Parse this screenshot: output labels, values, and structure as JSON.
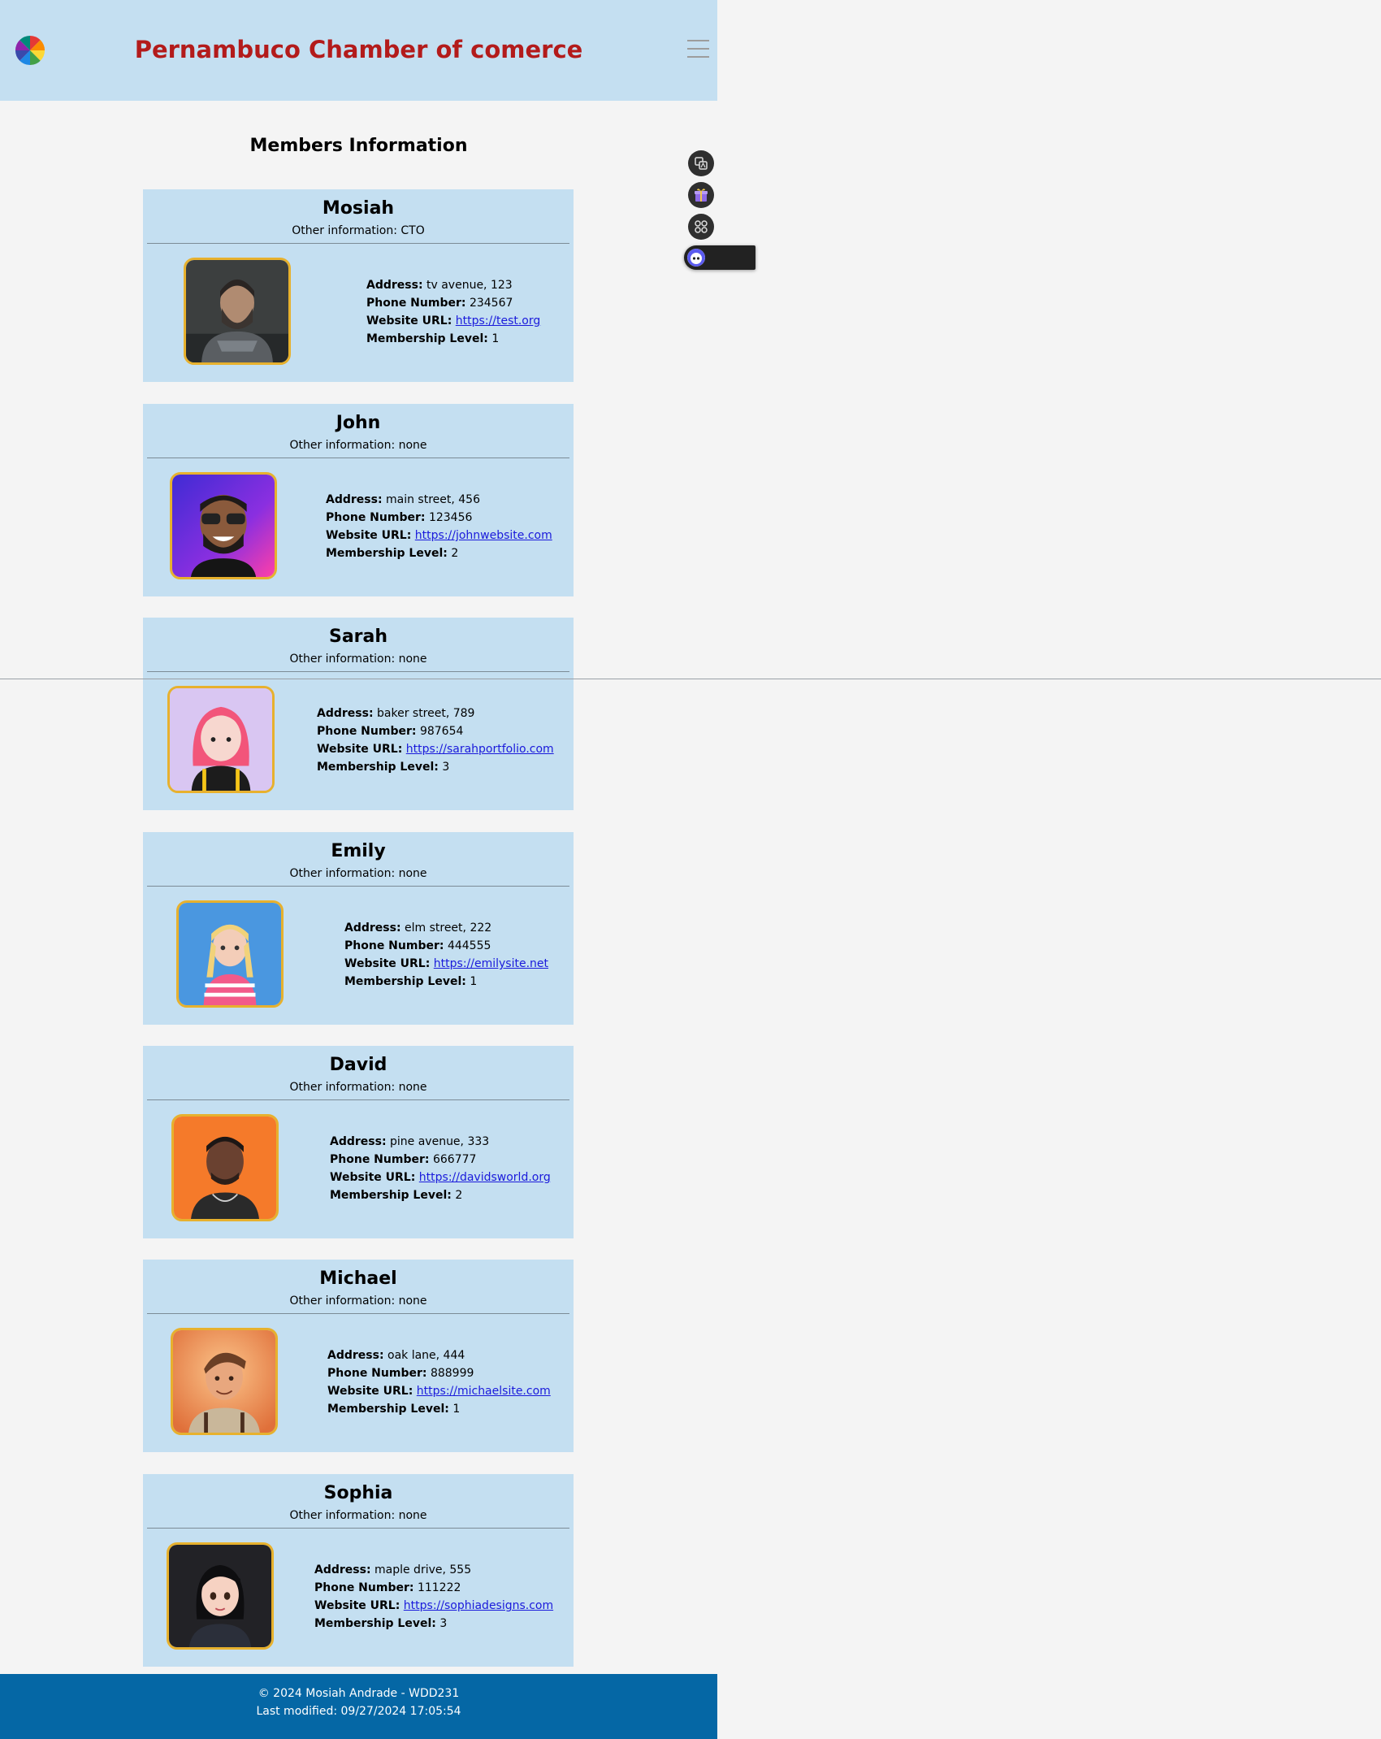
{
  "header": {
    "title": "Pernambuco Chamber of comerce",
    "logo_icon": "pinwheel-logo-icon",
    "menu_icon": "hamburger-menu-icon"
  },
  "main": {
    "title": "Members Information",
    "labels": {
      "address": "Address:",
      "phone": "Phone Number:",
      "website": "Website URL:",
      "level": "Membership Level:"
    },
    "members": [
      {
        "name": "Mosiah",
        "other": "Other information: CTO",
        "address": "tv avenue, 123",
        "phone": "234567",
        "website": "https://test.org",
        "level": "1"
      },
      {
        "name": "John",
        "other": "Other information: none",
        "address": "main street, 456",
        "phone": "123456",
        "website": "https://johnwebsite.com",
        "level": "2"
      },
      {
        "name": "Sarah",
        "other": "Other information: none",
        "address": "baker street, 789",
        "phone": "987654",
        "website": "https://sarahportfolio.com",
        "level": "3"
      },
      {
        "name": "Emily",
        "other": "Other information: none",
        "address": "elm street, 222",
        "phone": "444555",
        "website": "https://emilysite.net",
        "level": "1"
      },
      {
        "name": "David",
        "other": "Other information: none",
        "address": "pine avenue, 333",
        "phone": "666777",
        "website": "https://davidsworld.org",
        "level": "2"
      },
      {
        "name": "Michael",
        "other": "Other information: none",
        "address": "oak lane, 444",
        "phone": "888999",
        "website": "https://michaelsite.com",
        "level": "1"
      },
      {
        "name": "Sophia",
        "other": "Other information: none",
        "address": "maple drive, 555",
        "phone": "111222",
        "website": "https://sophiadesigns.com",
        "level": "3"
      }
    ]
  },
  "footer": {
    "copyright": "© 2024 Mosiah Andrade - WDD231",
    "last_modified": "Last modified: 09/27/2024 17:05:54"
  },
  "floating_toolbar": {
    "buttons": [
      "translate-icon",
      "gift-icon",
      "apps-grid-icon"
    ],
    "pill_icon": "assistant-face-icon"
  },
  "colors": {
    "header_bg": "#c4dff1",
    "title_red": "#b31b1b",
    "card_bg": "#c4dff1",
    "footer_bg": "#0567a5",
    "link": "#1a1adb",
    "avatar_border": "#e7b12e"
  }
}
